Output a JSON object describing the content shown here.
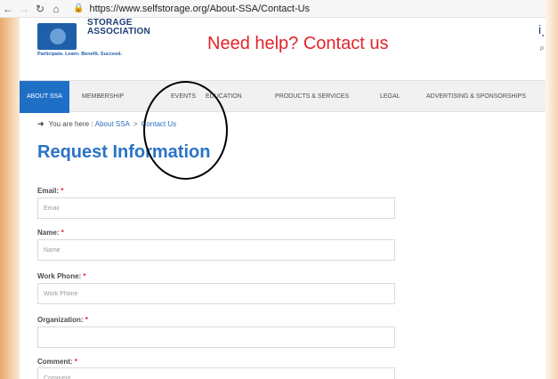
{
  "browser": {
    "url": "https://www.selfstorage.org/About-SSA/Contact-Us"
  },
  "header": {
    "logo_line1": "STORAGE",
    "logo_line2": "ASSOCIATION",
    "tagline": "Participate. Learn. Benefit. Succeed.",
    "headline": "Need help? Contact us",
    "right_glyph": "iˎ",
    "right_small": "P"
  },
  "nav": {
    "items": [
      {
        "label": "ABOUT SSA"
      },
      {
        "label": "MEMBERSHIP"
      },
      {
        "label": "EVENTS"
      },
      {
        "label": "EDUCATION"
      },
      {
        "label": "PRODUCTS & SERVICES"
      },
      {
        "label": "LEGAL"
      },
      {
        "label": "ADVERTISING & SPONSORSHIPS"
      }
    ]
  },
  "breadcrumb": {
    "prefix": "You are here :",
    "items": [
      "About SSA",
      "Contact Us"
    ],
    "separator": ">"
  },
  "page_title": "Request Information",
  "form": {
    "fields": [
      {
        "label": "Email:",
        "required": "*",
        "placeholder": "Email",
        "value": ""
      },
      {
        "label": "Name:",
        "required": "*",
        "placeholder": "Name",
        "value": ""
      },
      {
        "label": "Work Phone:",
        "required": "*",
        "placeholder": "Work Phone",
        "value": ""
      },
      {
        "label": "Organization:",
        "required": "*",
        "placeholder": "",
        "value": ""
      },
      {
        "label": "Comment:",
        "required": "*",
        "placeholder": "Comment",
        "value": ""
      }
    ]
  },
  "colors": {
    "accent": "#1f6fc7",
    "headline": "#e3232c",
    "title": "#2a73c6"
  }
}
